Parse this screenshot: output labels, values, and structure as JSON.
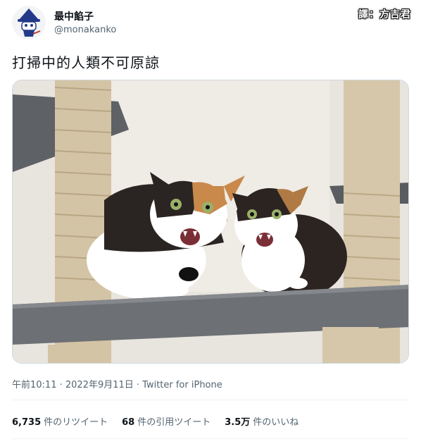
{
  "author": {
    "display_name": "最中餡子",
    "handle": "@monakanko",
    "avatar_icon": "witch-cat-avatar-icon"
  },
  "translator_badge": "譯：方吉君",
  "tweet": {
    "text": "打掃中的人類不可原諒",
    "photo_icon": "two-hissing-calico-cats-photo"
  },
  "meta": {
    "line": "午前10:11 · 2022年9月11日 · Twitter for iPhone"
  },
  "stats": [
    {
      "value": "6,735",
      "label": "件のリツイート"
    },
    {
      "value": "68",
      "label": "件の引用ツイート"
    },
    {
      "value": "3.5万",
      "label": "件のいいね"
    }
  ]
}
